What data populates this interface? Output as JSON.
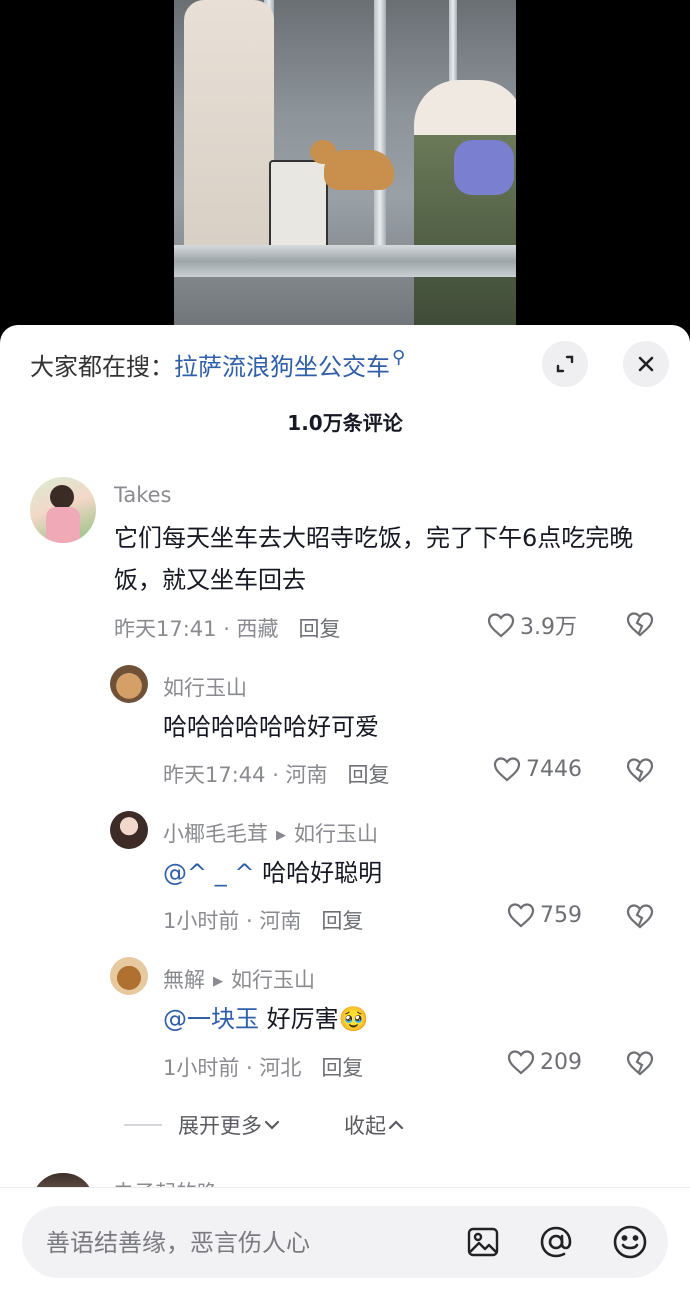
{
  "search": {
    "prefix": "大家都在搜：",
    "keyword": "拉萨流浪狗坐公交车"
  },
  "comments_count": "1.0万条评论",
  "comments": [
    {
      "user": "Takes",
      "text": "它们每天坐车去大昭寺吃饭，完了下午6点吃完晚饭，就又坐车回去",
      "time": "昨天17:41 · 西藏",
      "reply_label": "回复",
      "likes": "3.9万"
    }
  ],
  "replies": [
    {
      "user": "如行玉山",
      "reply_to": "",
      "mention": "",
      "text": "哈哈哈哈哈哈好可爱",
      "time": "昨天17:44 · 河南",
      "reply_label": "回复",
      "likes": "7446"
    },
    {
      "user": "小椰毛毛茸",
      "reply_to": "如行玉山",
      "mention": "@^ _ ^",
      "text": "哈哈好聪明",
      "time": "1小时前 · 河南",
      "reply_label": "回复",
      "likes": "759"
    },
    {
      "user": "無解",
      "reply_to": "如行玉山",
      "mention": "@一块玉",
      "text": "好厉害🥹",
      "time": "1小时前 · 河北",
      "reply_label": "回复",
      "likes": "209"
    }
  ],
  "expand": {
    "more": "展开更多",
    "collapse": "收起"
  },
  "next_comment_user": "虫子起的晚",
  "input": {
    "placeholder": "善语结善缘，恶言伤人心"
  },
  "icons": [
    "magnifier-icon",
    "expand-icon",
    "close-icon",
    "heart-icon",
    "broken-heart-icon",
    "chevron-down-icon",
    "chevron-up-icon",
    "image-icon",
    "at-icon",
    "emoji-icon"
  ],
  "colors": {
    "link": "#2f5fa8",
    "muted": "#8a8b91",
    "text": "#161823"
  }
}
